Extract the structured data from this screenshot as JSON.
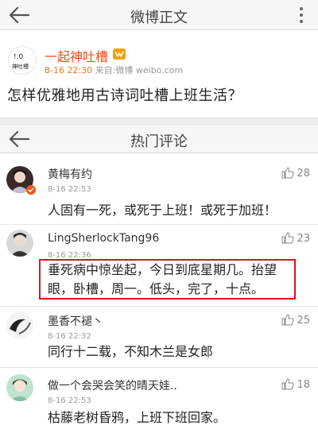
{
  "header": {
    "title": "微博正文"
  },
  "post": {
    "author": "一起神吐槽",
    "avatar_text": "!.0 神吐槽",
    "time": "8-16 22:30",
    "source": "来自:微博 weibo.com",
    "text": "怎样优雅地用古诗词吐槽上班生活？"
  },
  "hot_comments": {
    "title": "热门评论"
  },
  "comments": [
    {
      "user": "黄梅有约",
      "time": "8-16 22:53",
      "text": "人固有一死，或死于上班！或死于加班！",
      "likes": "28"
    },
    {
      "user": "LingSherlockTang96",
      "time": "8-16 22:36",
      "text_line1": "垂死病中惊坐起，今日到底星期几。抬望",
      "text_line2": "眼，卧槽，周一。低头，完了，十点。",
      "likes": "23"
    },
    {
      "user": "墨香不褪丶",
      "time": "8-16 22:32",
      "text": "同行十二载，不知木兰是女郎",
      "likes": "25"
    },
    {
      "user": "做一个会哭会笑的晴天娃..",
      "time": "8-16 22:53",
      "text": "枯藤老树昏鸦，上班下班回家。",
      "likes": "18"
    }
  ],
  "colors": {
    "accent": "#e8501e",
    "highlight_border": "#d8141e"
  }
}
